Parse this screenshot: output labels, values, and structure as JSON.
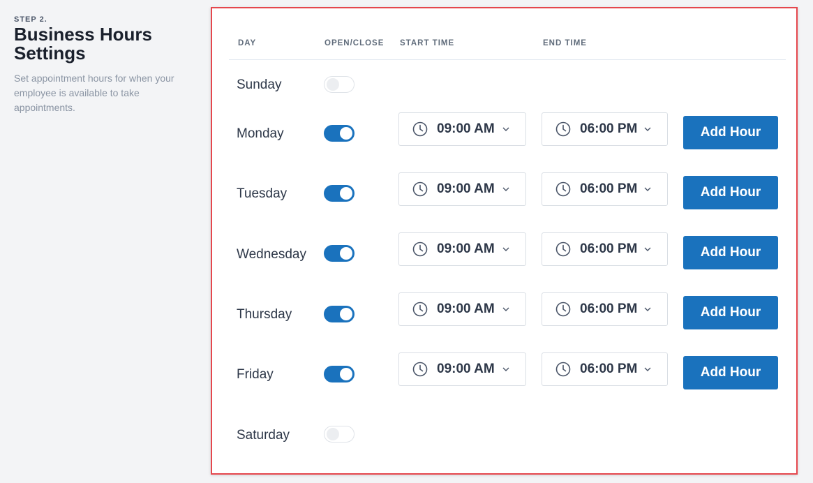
{
  "sidebar": {
    "step": "STEP 2.",
    "title": "Business Hours Settings",
    "description": "Set appointment hours for when your employee is available to take appointments."
  },
  "table": {
    "headers": {
      "day": "DAY",
      "open_close": "OPEN/CLOSE",
      "start_time": "START TIME",
      "end_time": "END TIME"
    },
    "add_label": "Add Hour",
    "rows": [
      {
        "day": "Sunday",
        "open": false
      },
      {
        "day": "Monday",
        "open": true,
        "start": "09:00 AM",
        "end": "06:00 PM"
      },
      {
        "day": "Tuesday",
        "open": true,
        "start": "09:00 AM",
        "end": "06:00 PM"
      },
      {
        "day": "Wednesday",
        "open": true,
        "start": "09:00 AM",
        "end": "06:00 PM"
      },
      {
        "day": "Thursday",
        "open": true,
        "start": "09:00 AM",
        "end": "06:00 PM"
      },
      {
        "day": "Friday",
        "open": true,
        "start": "09:00 AM",
        "end": "06:00 PM"
      },
      {
        "day": "Saturday",
        "open": false
      }
    ]
  },
  "colors": {
    "accent": "#1a72bd",
    "highlight_border": "#e5474d"
  }
}
